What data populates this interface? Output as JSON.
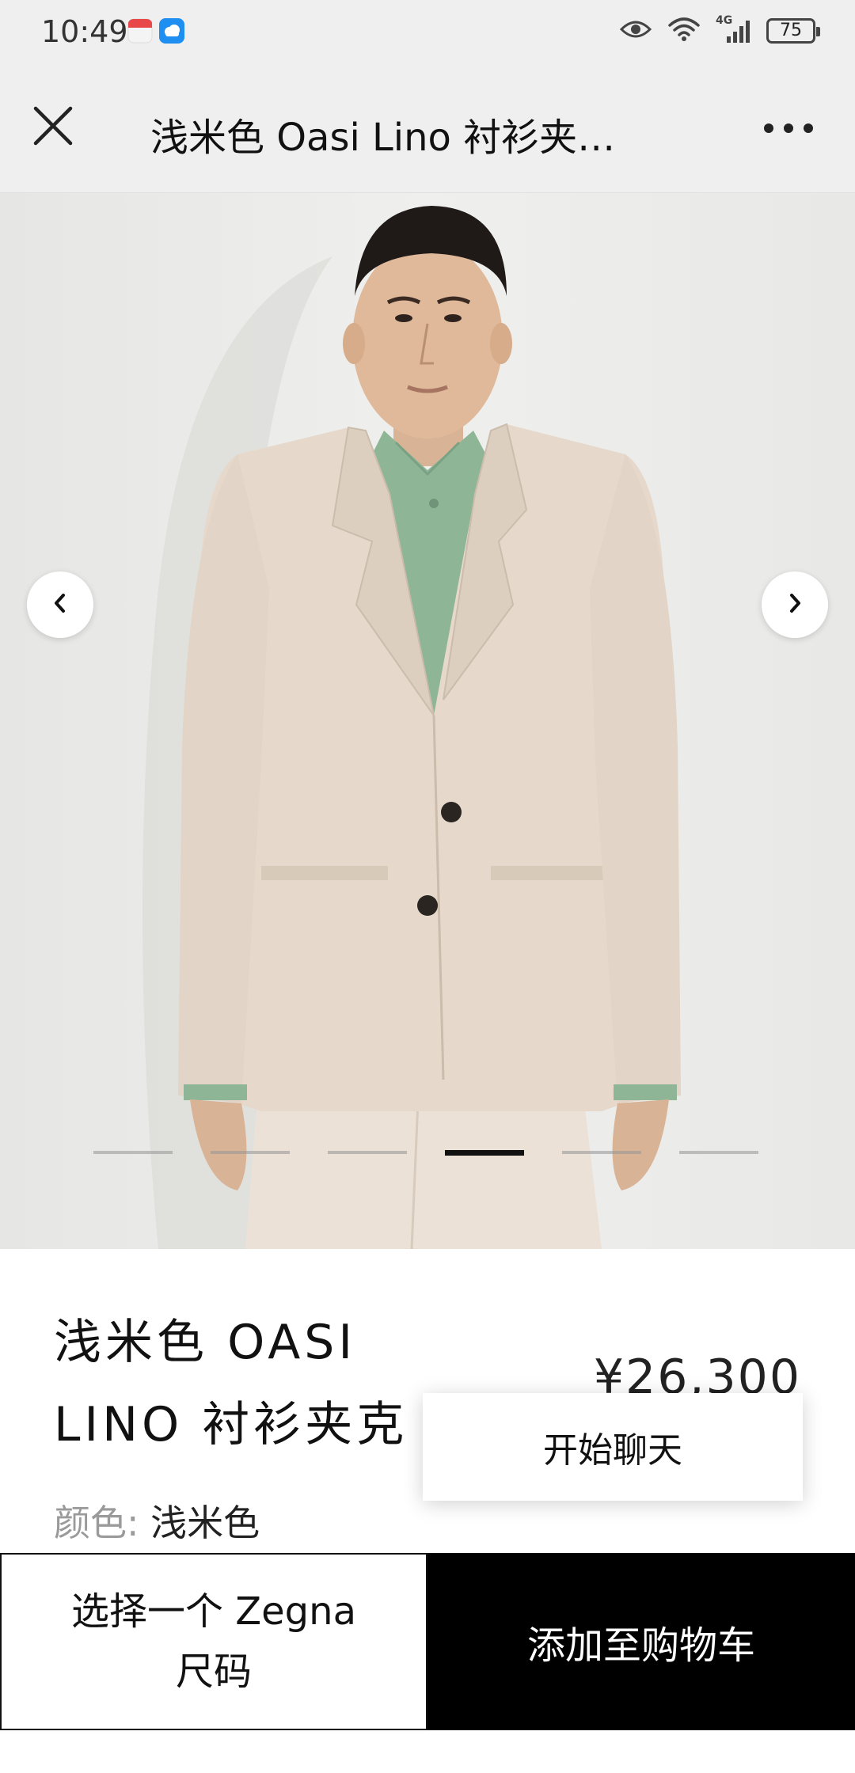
{
  "status_bar": {
    "time": "10:49",
    "battery_level": "75",
    "icons": [
      "calendar-app-icon",
      "weather-app-icon",
      "eye-icon",
      "wifi-icon",
      "cellular-signal-icon",
      "battery-icon"
    ],
    "network_label": "4G"
  },
  "header": {
    "title": "浅米色 Oasi Lino 衬衫夹…",
    "close_icon": "close-icon",
    "more_icon": "more-horizontal-icon"
  },
  "gallery": {
    "image_alt": "浅米色 Oasi Lino 衬衫夹克",
    "prev_icon": "chevron-left-icon",
    "next_icon": "chevron-right-icon",
    "total_slides": 6,
    "active_slide": 4
  },
  "product": {
    "title_line1": "浅米色 OASI",
    "title_line2": "LINO 衬衫夹克",
    "price": "¥26,300",
    "color_label": "颜色:",
    "color_value": "浅米色"
  },
  "popup": {
    "label": "开始聊天"
  },
  "actions": {
    "size_line1": "选择一个 Zegna",
    "size_line2": "尺码",
    "add_to_cart": "添加至购物车"
  },
  "colors": {
    "jacket": "#e6d9cc",
    "shirt": "#8fb597",
    "background": "#ececea",
    "cta_background": "#000000"
  }
}
